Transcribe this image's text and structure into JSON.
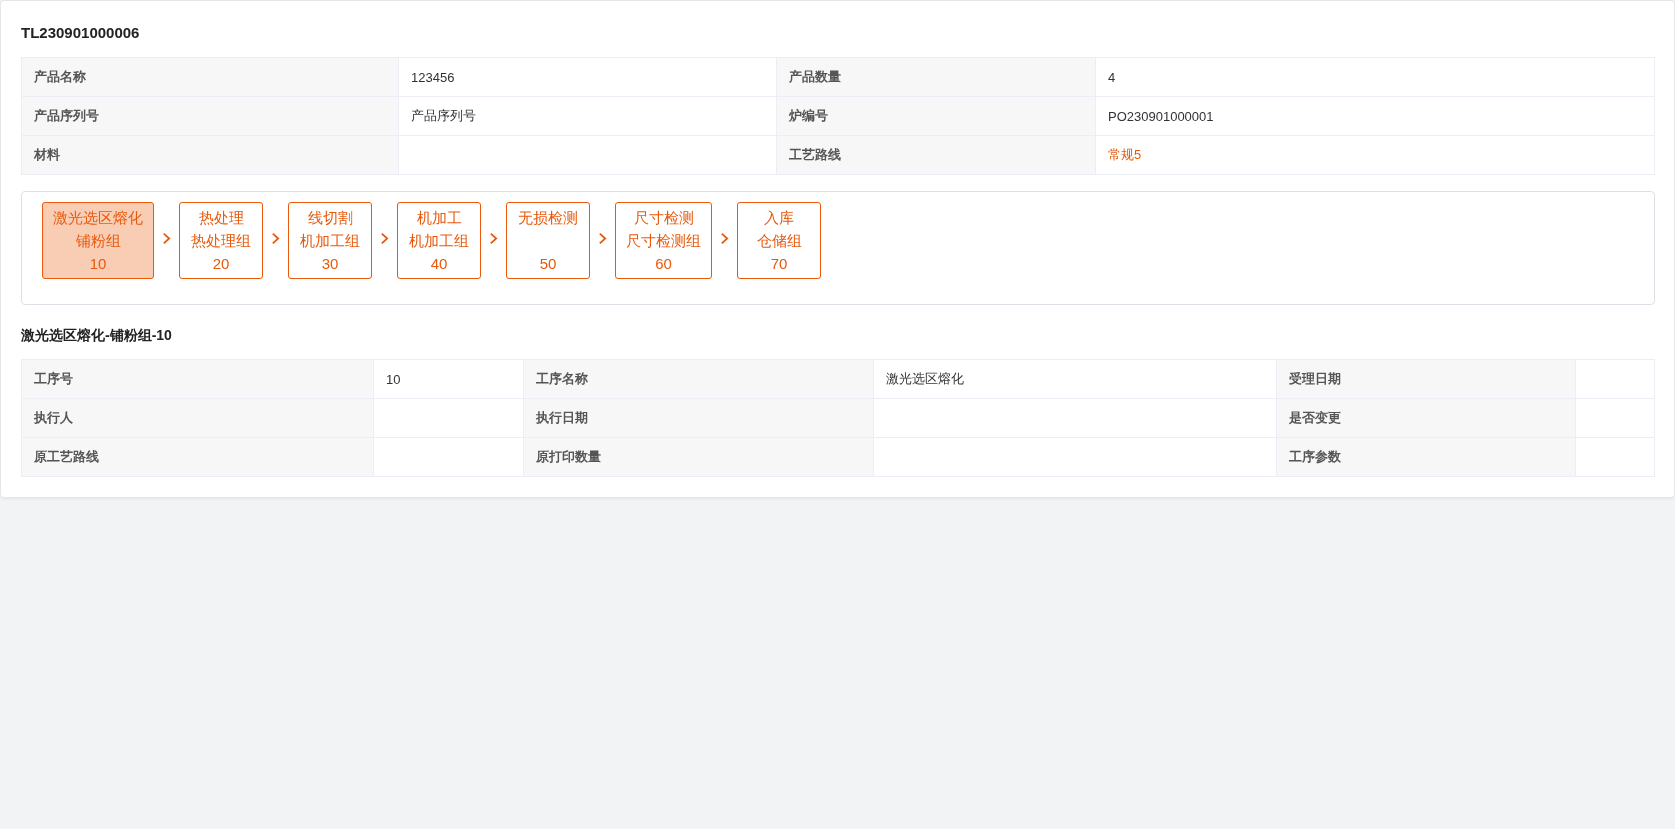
{
  "order_title": "TL230901000006",
  "product_info": [
    {
      "label": "产品名称",
      "value": "123456",
      "kind": "text"
    },
    {
      "label": "产品数量",
      "value": "4",
      "kind": "text"
    },
    {
      "label": "产品序列号",
      "value": "产品序列号",
      "kind": "text"
    },
    {
      "label": "炉编号",
      "value": "PO230901000001",
      "kind": "text"
    },
    {
      "label": "材料",
      "kind": "text"
    },
    {
      "label": "工艺路线",
      "value": "常规5",
      "kind": "link"
    }
  ],
  "process_steps": [
    {
      "name": "激光选区熔化",
      "group": "铺粉组",
      "number": "10",
      "selected": true
    },
    {
      "name": "热处理",
      "group": "热处理组",
      "number": "20",
      "selected": false
    },
    {
      "name": "线切割",
      "group": "机加工组",
      "number": "30",
      "selected": false
    },
    {
      "name": "机加工",
      "group": "机加工组",
      "number": "40",
      "selected": false
    },
    {
      "name": "无损检测",
      "number": "50",
      "selected": false
    },
    {
      "name": "尺寸检测",
      "group": "尺寸检测组",
      "number": "60",
      "selected": false
    },
    {
      "name": "入库",
      "group": "仓储组",
      "number": "70",
      "selected": false
    }
  ],
  "step_title": "激光选区熔化-铺粉组-10",
  "step_info": [
    {
      "label": "工序号",
      "value": "10"
    },
    {
      "label": "工序名称",
      "value": "激光选区熔化"
    },
    {
      "label": "受理日期"
    },
    {
      "label": "执行人"
    },
    {
      "label": "执行日期"
    },
    {
      "label": "是否变更"
    },
    {
      "label": "原工艺路线"
    },
    {
      "label": "原打印数量"
    },
    {
      "label": "工序参数"
    }
  ]
}
